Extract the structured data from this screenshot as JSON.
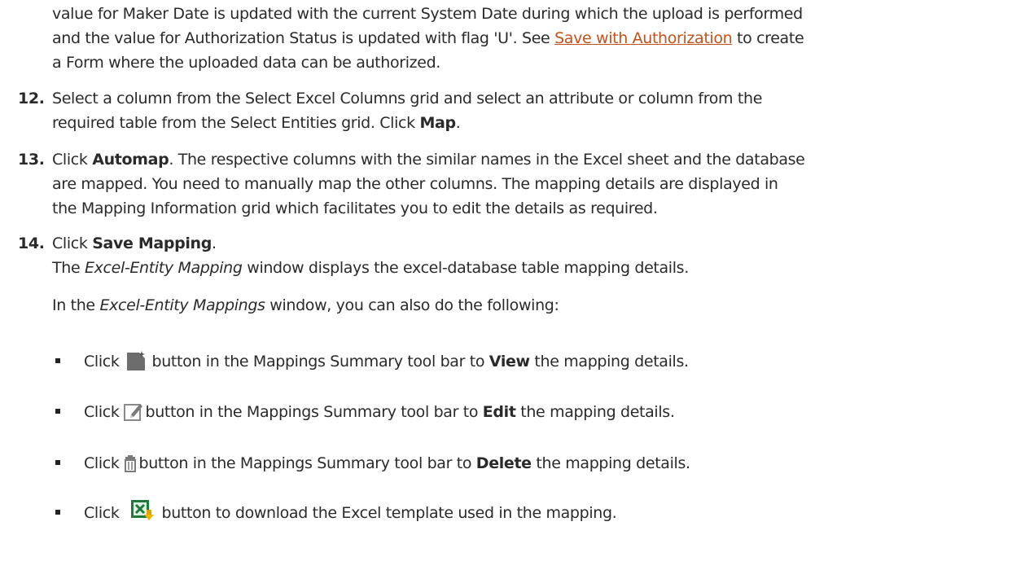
{
  "intro": {
    "line1": "value for Maker Date is updated with the current System Date during which the upload is performed",
    "line2_a": "and the value for Authorization Status is updated with flag 'U'. See ",
    "line2_link": "Save with Authorization",
    "line2_b": " to create",
    "line3": "a Form where the uploaded data can be authorized."
  },
  "steps": [
    {
      "number": "12.",
      "line1": "Select a column from the Select Excel Columns grid and select an attribute or column from the",
      "line2_a": "required table from the Select Entities grid. Click ",
      "line2_bold": "Map",
      "line2_b": "."
    },
    {
      "number": "13.",
      "line1_a": "Click ",
      "line1_bold": "Automap",
      "line1_b": ". The respective columns with the similar names in the Excel sheet and the database",
      "line2": "are mapped. You need to manually map the other columns. The mapping details are displayed in",
      "line3": "the Mapping Information grid which facilitates you to edit the details as required."
    },
    {
      "number": "14.",
      "line1_a": "Click ",
      "line1_bold": "Save Mapping",
      "line1_b": ".",
      "line2_a": "The ",
      "line2_italic": "Excel-Entity Mapping",
      "line2_b": " window displays the excel-database table mapping details.",
      "line3_a": "In the ",
      "line3_italic": "Excel-Entity Mappings",
      "line3_b": " window, you can also do the following:"
    }
  ],
  "bullets": [
    {
      "pre": "Click",
      "icon": "view-icon",
      "mid": "button in the Mappings Summary tool bar to ",
      "bold": "View",
      "post": " the mapping details."
    },
    {
      "pre": "Click",
      "icon": "edit-icon",
      "mid": "button in the Mappings Summary tool bar to ",
      "bold": "Edit",
      "post": " the mapping details."
    },
    {
      "pre": "Click",
      "icon": "delete-icon",
      "mid": "button in the Mappings Summary tool bar to ",
      "bold": "Delete",
      "post": " the mapping details."
    },
    {
      "pre": "Click",
      "icon": "excel-download-icon",
      "mid": "button to download the Excel template used in the mapping.",
      "bold": "",
      "post": ""
    }
  ]
}
